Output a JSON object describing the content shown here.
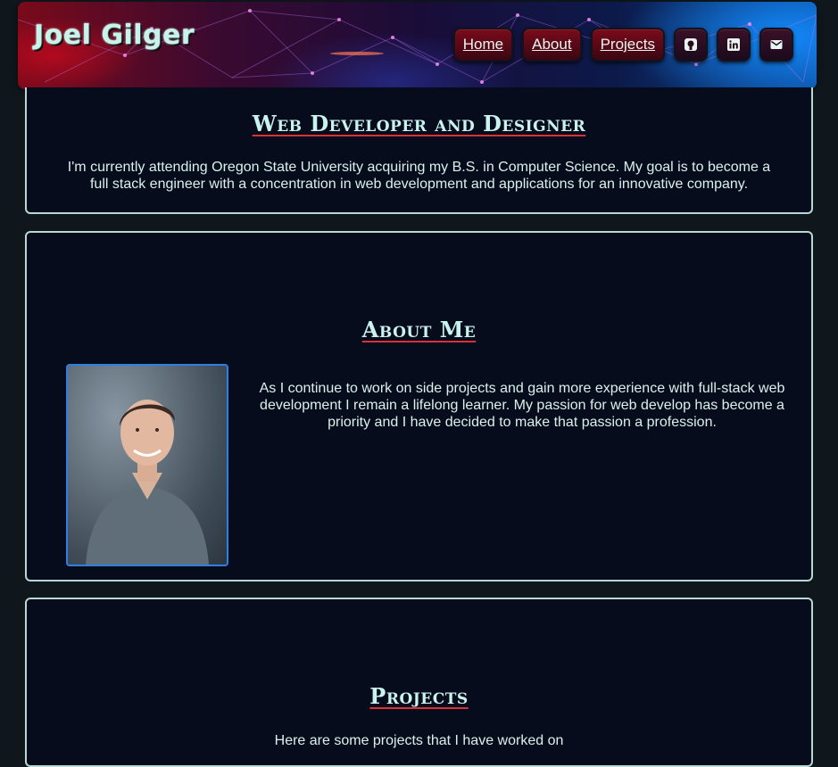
{
  "header": {
    "brand": "Joel Gilger",
    "nav": [
      {
        "label": "Home"
      },
      {
        "label": "About"
      },
      {
        "label": "Projects"
      }
    ],
    "icons": [
      "github-icon",
      "linkedin-icon",
      "email-icon"
    ]
  },
  "intro": {
    "heading": "Web Developer and Designer",
    "text": "I'm currently attending Oregon State University acquiring my B.S. in Computer Science. My goal is to become a full stack engineer with a concentration in web development and applications for an innovative company."
  },
  "about": {
    "heading": "About Me",
    "text": "As I continue to work on side projects and gain more experience with full-stack web development I remain a lifelong learner. My passion for web develop has become a priority and I have decided to make that passion a profession."
  },
  "projects": {
    "heading": "Projects",
    "text": "Here are some projects that I have worked on"
  },
  "colors": {
    "accent_red": "#d9303a",
    "heading_text": "#c8f3ee",
    "card_bg": "#070c1c",
    "card_border": "#b7d8d3"
  }
}
